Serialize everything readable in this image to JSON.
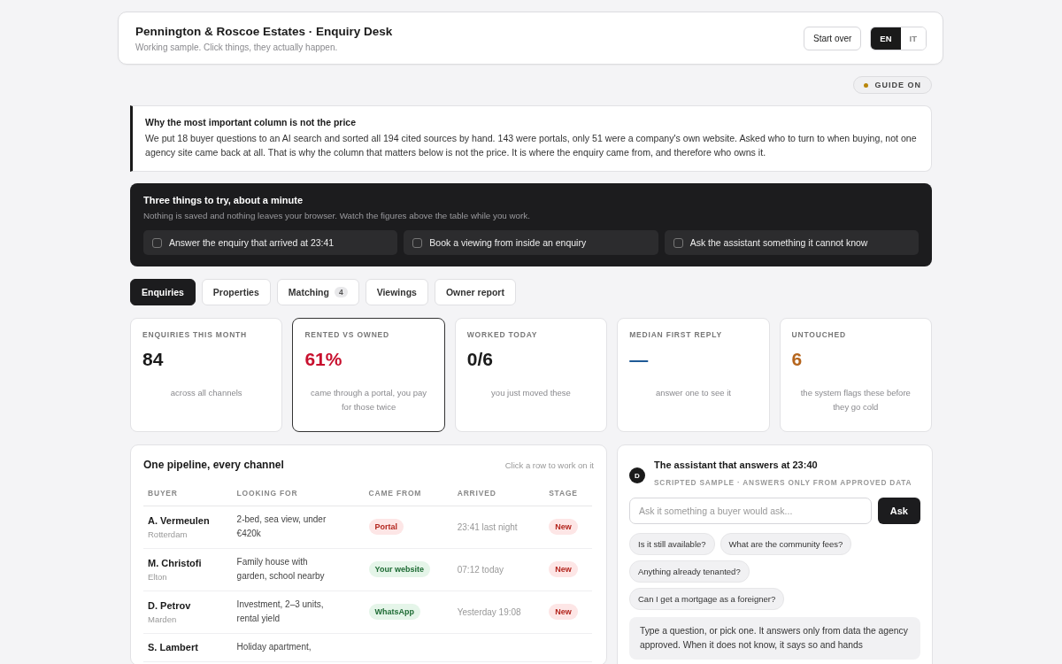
{
  "header": {
    "title": "Pennington & Roscoe Estates · Enquiry Desk",
    "subtitle": "Working sample. Click things, they actually happen.",
    "start_over": "Start over",
    "languages": [
      {
        "label": "EN",
        "selected": true
      },
      {
        "label": "IT",
        "selected": false
      }
    ]
  },
  "guide": {
    "label": "GUIDE ON",
    "on": true
  },
  "note": {
    "title": "Why the most important column is not the price",
    "body": "We put 18 buyer questions to an AI search and sorted all 194 cited sources by hand. 143 were portals, only 51 were a company's own website. Asked who to turn to when buying, not one agency site came back at all. That is why the column that matters below is not the price. It is where the enquiry came from, and therefore who owns it."
  },
  "tasks": {
    "title": "Three things to try, about a minute",
    "subtitle": "Nothing is saved and nothing leaves your browser. Watch the figures above the table while you work.",
    "items": [
      {
        "label": "Answer the enquiry that arrived at 23:41",
        "checked": false
      },
      {
        "label": "Book a viewing from inside an enquiry",
        "checked": false
      },
      {
        "label": "Ask the assistant something it cannot know",
        "checked": false
      }
    ]
  },
  "tabs": [
    {
      "label": "Enquiries",
      "selected": true
    },
    {
      "label": "Properties",
      "selected": false
    },
    {
      "label": "Matching",
      "count": "4",
      "selected": false
    },
    {
      "label": "Viewings",
      "selected": false
    },
    {
      "label": "Owner report",
      "selected": false
    }
  ],
  "stats": [
    {
      "label": "ENQUIRIES THIS MONTH",
      "value": "84",
      "color": "#1a1a1a",
      "note": "across all channels",
      "selected": false
    },
    {
      "label": "RENTED VS OWNED",
      "value": "61%",
      "color": "#c8102e",
      "note": "came through a portal, you pay for those twice",
      "selected": true
    },
    {
      "label": "WORKED TODAY",
      "value": "0/6",
      "color": "#1a1a1a",
      "note": "you just moved these",
      "selected": false
    },
    {
      "label": "MEDIAN FIRST REPLY",
      "value": "—",
      "color": "#1f5a96",
      "note": "answer one to see it",
      "selected": false
    },
    {
      "label": "UNTOUCHED",
      "value": "6",
      "color": "#b5651d",
      "note": "the system flags these before they go cold",
      "selected": false
    }
  ],
  "pipeline": {
    "title": "One pipeline, every channel",
    "hint": "Click a row to work on it",
    "columns": [
      "BUYER",
      "LOOKING FOR",
      "CAME FROM",
      "ARRIVED",
      "STAGE"
    ],
    "rows": [
      {
        "buyer": "A. Vermeulen",
        "place": "Rotterdam",
        "looking_for": "2-bed, sea view, under €420k",
        "came_from": {
          "label": "Portal",
          "kind": "portal"
        },
        "arrived": "23:41 last night",
        "stage": "New"
      },
      {
        "buyer": "M. Christofi",
        "place": "Elton",
        "looking_for": "Family house with garden, school nearby",
        "came_from": {
          "label": "Your website",
          "kind": "owned"
        },
        "arrived": "07:12 today",
        "stage": "New"
      },
      {
        "buyer": "D. Petrov",
        "place": "Marden",
        "looking_for": "Investment, 2–3 units, rental yield",
        "came_from": {
          "label": "WhatsApp",
          "kind": "owned"
        },
        "arrived": "Yesterday 19:08",
        "stage": "New"
      },
      {
        "buyer": "S. Lambert",
        "looking_for": "Holiday apartment,"
      }
    ]
  },
  "assistant": {
    "avatar": "D",
    "title": "The assistant that answers at 23:40",
    "subtitle": "SCRIPTED SAMPLE · ANSWERS ONLY FROM APPROVED DATA",
    "placeholder": "Ask it something a buyer would ask...",
    "ask": "Ask",
    "suggestions": [
      "Is it still available?",
      "What are the community fees?",
      "Anything already tenanted?",
      "Can I get a mortgage as a foreigner?"
    ],
    "message": "Type a question, or pick one. It answers only from data the agency approved. When it does not know, it says so and hands"
  }
}
